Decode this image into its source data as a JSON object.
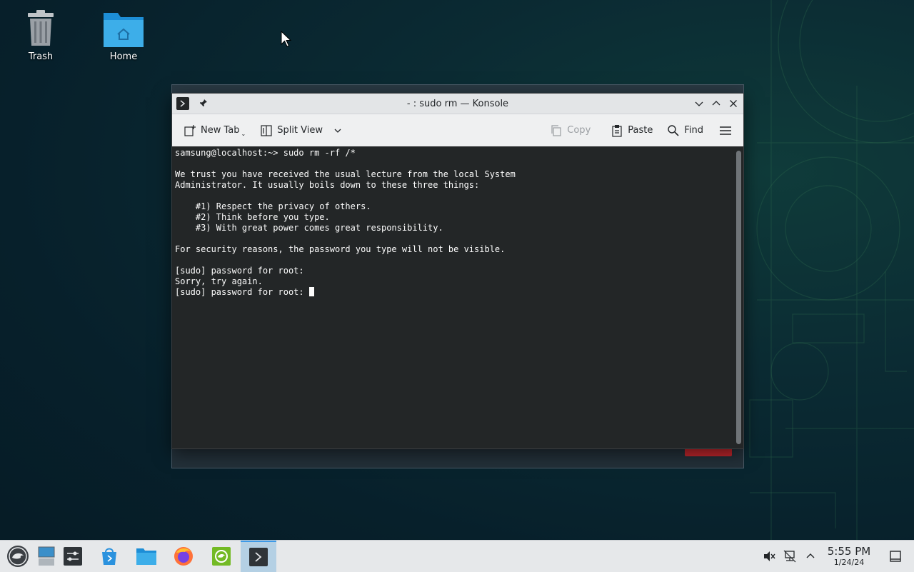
{
  "desktop": {
    "icons": [
      {
        "label": "Trash",
        "icon": "trash-icon"
      },
      {
        "label": "Home",
        "icon": "home-folder-icon"
      }
    ]
  },
  "konsole": {
    "title": "- : sudo rm — Konsole",
    "toolbar": {
      "new_tab": "New Tab",
      "split_view": "Split View",
      "copy": "Copy",
      "paste": "Paste",
      "find": "Find"
    },
    "terminal_lines": [
      "samsung@localhost:~> sudo rm -rf /*",
      "",
      "We trust you have received the usual lecture from the local System",
      "Administrator. It usually boils down to these three things:",
      "",
      "    #1) Respect the privacy of others.",
      "    #2) Think before you type.",
      "    #3) With great power comes great responsibility.",
      "",
      "For security reasons, the password you type will not be visible.",
      "",
      "[sudo] password for root:",
      "Sorry, try again."
    ],
    "prompt_line": "[sudo] password for root: "
  },
  "taskbar": {
    "items": [
      "application-launcher-icon",
      "show-desktop-icon",
      "system-settings-icon",
      "discover-icon",
      "dolphin-icon",
      "firefox-icon",
      "opensuse-welcome-icon",
      "konsole-icon"
    ],
    "active_item": "konsole-icon",
    "clock": {
      "time": "5:55 PM",
      "date": "1/24/24"
    },
    "tray": [
      "volume-muted-icon",
      "network-icon",
      "tray-expand-icon",
      "peek-desktop-icon"
    ]
  },
  "colors": {
    "accent": "#3d9ae8",
    "terminal_bg": "#232627",
    "terminal_fg": "#fcfcfc"
  }
}
